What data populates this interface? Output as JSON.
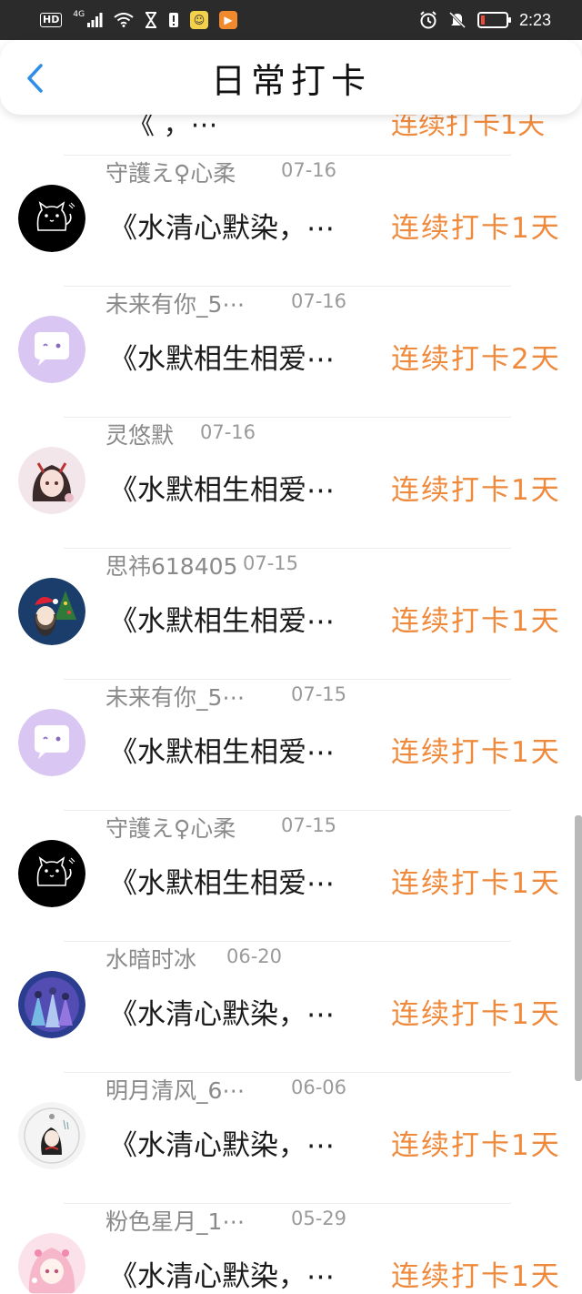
{
  "status_bar": {
    "hd": "HD",
    "network": "4G",
    "time": "2:23"
  },
  "header": {
    "title": "日常打卡"
  },
  "partial_item": {
    "content": "《 ，⋯",
    "streak": "连续打卡1天"
  },
  "items": [
    {
      "avatar": "black-cat",
      "username": "守護え♀心柔",
      "date": "07-16",
      "content": "《水清心默染，⋯",
      "streak": "连续打卡1天"
    },
    {
      "avatar": "purple-chat",
      "username": "未来有你_5⋯",
      "date": "07-16",
      "content": "《水默相生相爱⋯",
      "streak": "连续打卡2天"
    },
    {
      "avatar": "anime-girl-pink",
      "username": "灵悠默",
      "date": "07-16",
      "content": "《水默相生相爱⋯",
      "streak": "连续打卡1天"
    },
    {
      "avatar": "christmas-girl",
      "username": "思祎618405",
      "date": "07-15",
      "content": "《水默相生相爱⋯",
      "streak": "连续打卡1天"
    },
    {
      "avatar": "purple-chat",
      "username": "未来有你_5⋯",
      "date": "07-15",
      "content": "《水默相生相爱⋯",
      "streak": "连续打卡1天"
    },
    {
      "avatar": "black-cat",
      "username": "守護え♀心柔",
      "date": "07-15",
      "content": "《水默相生相爱⋯",
      "streak": "连续打卡1天"
    },
    {
      "avatar": "blue-group",
      "username": "水暗时冰",
      "date": "06-20",
      "content": "《水清心默染，⋯",
      "streak": "连续打卡1天"
    },
    {
      "avatar": "chibi-white",
      "username": "明月清风_6⋯",
      "date": "06-06",
      "content": "《水清心默染，⋯",
      "streak": "连续打卡1天"
    },
    {
      "avatar": "pink-girl",
      "username": "粉色星月_1⋯",
      "date": "05-29",
      "content": "《水清心默染，⋯",
      "streak": "连续打卡1天"
    }
  ],
  "colors": {
    "accent": "#ef8a3d",
    "back": "#2f8fe8",
    "status_bar": "#2b2b2b"
  }
}
